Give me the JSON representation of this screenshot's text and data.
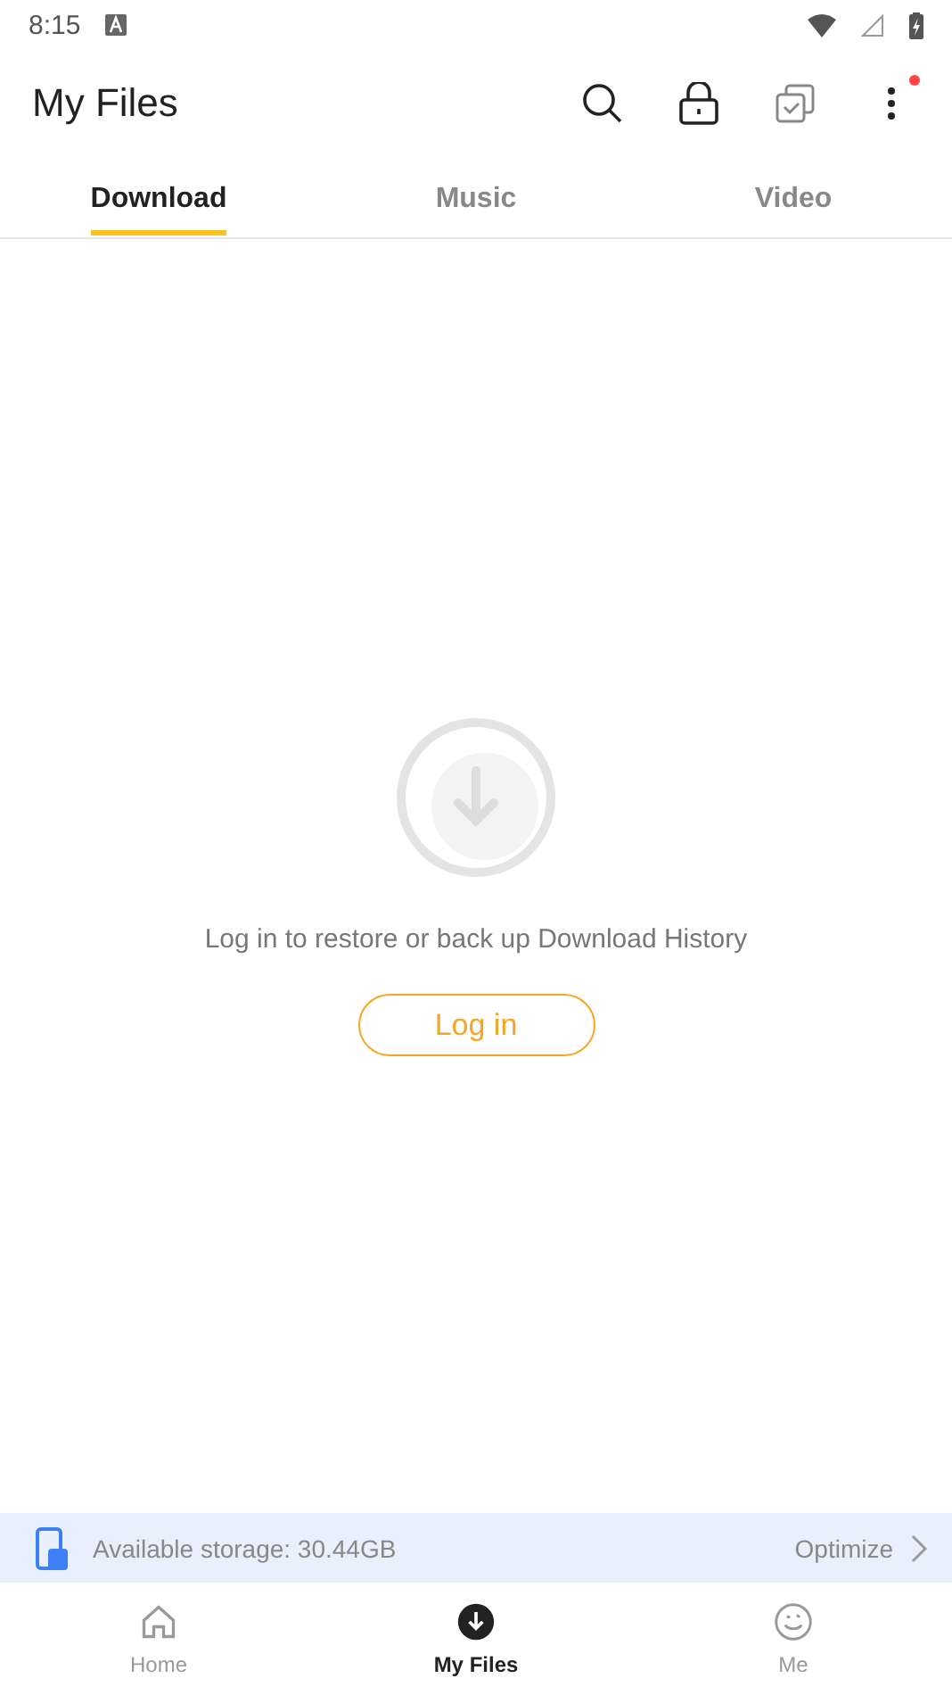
{
  "status_bar": {
    "time": "8:15"
  },
  "header": {
    "title": "My Files",
    "menu_badge": true
  },
  "tabs": [
    {
      "label": "Download",
      "selected": true
    },
    {
      "label": "Music",
      "selected": false
    },
    {
      "label": "Video",
      "selected": false
    }
  ],
  "empty_state": {
    "message": "Log in to restore or back up Download History",
    "button": "Log in"
  },
  "storage": {
    "text": "Available storage: 30.44GB",
    "action": "Optimize"
  },
  "nav": [
    {
      "kind": "home",
      "label": "Home",
      "selected": false
    },
    {
      "kind": "files",
      "label": "My Files",
      "selected": true
    },
    {
      "kind": "me",
      "label": "Me",
      "selected": false
    }
  ]
}
